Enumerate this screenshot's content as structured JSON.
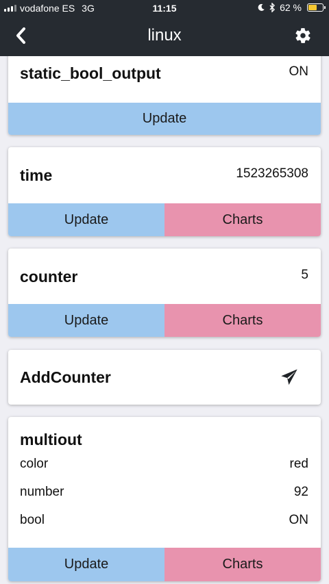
{
  "status_bar": {
    "carrier": "vodafone ES",
    "network": "3G",
    "time": "11:15",
    "battery_percent": "62 %",
    "battery_level": 0.62,
    "battery_color": "#f5c832"
  },
  "navbar": {
    "back_icon": "chevron-left-icon",
    "title": "linux",
    "settings_icon": "gear-icon"
  },
  "colors": {
    "header_bg": "#262b31",
    "page_bg": "#efeff4",
    "update_button": "#9dc7ee",
    "charts_button": "#e893ae"
  },
  "cards": {
    "static_bool_output": {
      "name": "static_bool_output",
      "value": "ON",
      "update_label": "Update"
    },
    "time": {
      "name": "time",
      "value": "1523265308",
      "update_label": "Update",
      "charts_label": "Charts"
    },
    "counter": {
      "name": "counter",
      "value": "5",
      "update_label": "Update",
      "charts_label": "Charts"
    },
    "add_counter": {
      "name": "AddCounter",
      "action_icon": "send-icon"
    },
    "multiout": {
      "name": "multiout",
      "rows": [
        {
          "label": "color",
          "value": "red"
        },
        {
          "label": "number",
          "value": "92"
        },
        {
          "label": "bool",
          "value": "ON"
        }
      ],
      "update_label": "Update",
      "charts_label": "Charts"
    }
  }
}
